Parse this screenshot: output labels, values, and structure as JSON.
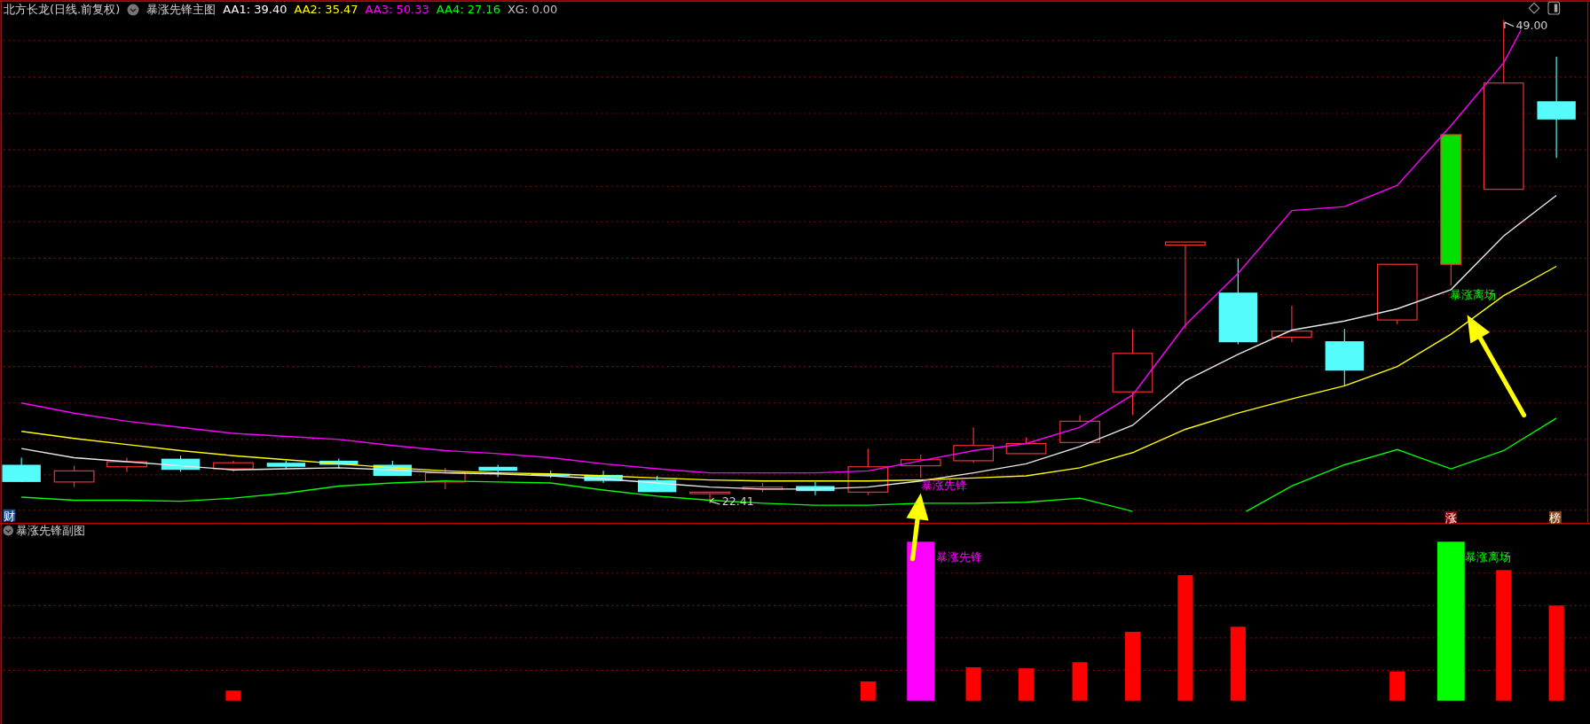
{
  "header": {
    "stock": "北方长龙(日线.前复权)",
    "indicator": "暴涨先锋主图",
    "values": [
      {
        "label": "AA1: 39.40",
        "color": "#ffffff"
      },
      {
        "label": "AA2: 35.47",
        "color": "#ffff00"
      },
      {
        "label": "AA3: 50.33",
        "color": "#ff00ff"
      },
      {
        "label": "AA4: 27.16",
        "color": "#00ff00"
      },
      {
        "label": "XG: 0.00",
        "color": "#c0c0c0"
      }
    ]
  },
  "main_chart": {
    "high_label": "49.00",
    "low_label": "22.41",
    "signals": [
      {
        "text": "暴涨先锋",
        "color": "#ff00ff"
      },
      {
        "text": "暴涨离场",
        "color": "#00ff00"
      }
    ],
    "markers": [
      {
        "text": "财",
        "kind": "finance"
      },
      {
        "text": "涨",
        "kind": "rise"
      },
      {
        "text": "榜",
        "kind": "list"
      }
    ]
  },
  "sub_chart": {
    "title": "暴涨先锋副图",
    "signals": [
      {
        "text": "暴涨先锋",
        "color": "#ff00ff"
      },
      {
        "text": "暴涨离场",
        "color": "#00ff00"
      }
    ]
  }
}
